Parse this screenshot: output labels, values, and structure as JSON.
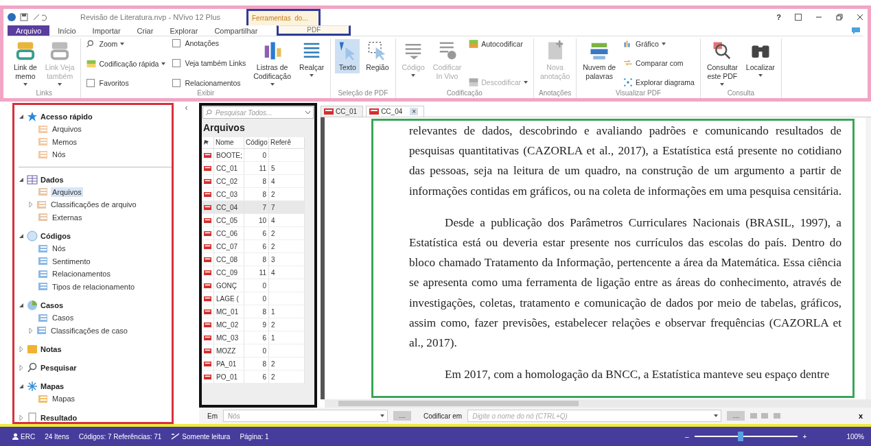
{
  "title_bar": {
    "title": "Revisão de Literatura.nvp - NVivo 12 Plus",
    "context_group": "Ferramentas  do...",
    "help": "?"
  },
  "ribbon_tabs": [
    {
      "label": "Arquivo",
      "selected": true
    },
    {
      "label": "Início",
      "selected": false
    },
    {
      "label": "Importar",
      "selected": false
    },
    {
      "label": "Criar",
      "selected": false
    },
    {
      "label": "Explorar",
      "selected": false
    },
    {
      "label": "Compartilhar",
      "selected": false
    }
  ],
  "context_tab": {
    "label": "PDF",
    "selected": false
  },
  "ribbon_groups": [
    {
      "label": "Links",
      "columns": [
        [
          {
            "kind": "large",
            "label": "Link de\nmemo",
            "dropdown": true,
            "disabled": false,
            "selected": false
          }
        ],
        [
          {
            "kind": "large",
            "label": "Link Veja\ntambém",
            "dropdown": true,
            "disabled": true,
            "selected": false
          }
        ]
      ]
    },
    {
      "label": "Exibir",
      "columns": [
        [
          {
            "kind": "small",
            "label": "Zoom",
            "dropdown": true,
            "disabled": false
          },
          {
            "kind": "small",
            "label": "Codificação rápida",
            "dropdown": true,
            "disabled": false
          },
          {
            "kind": "check",
            "label": "Favoritos",
            "checked": false
          }
        ],
        [
          {
            "kind": "check",
            "label": "Anotações",
            "checked": false
          },
          {
            "kind": "check",
            "label": "Veja também Links",
            "checked": false
          },
          {
            "kind": "check",
            "label": "Relacionamentos",
            "checked": false
          }
        ],
        [
          {
            "kind": "large",
            "label": "Listras de\nCodificação",
            "dropdown": true,
            "disabled": false,
            "selected": false
          }
        ],
        [
          {
            "kind": "large",
            "label": "Realçar",
            "dropdown": true,
            "disabled": false,
            "selected": false
          }
        ]
      ]
    },
    {
      "label": "Seleção de PDF",
      "columns": [
        [
          {
            "kind": "large",
            "label": "Texto",
            "dropdown": false,
            "disabled": false,
            "selected": true
          }
        ],
        [
          {
            "kind": "large",
            "label": "Região",
            "dropdown": false,
            "disabled": false,
            "selected": false
          }
        ]
      ]
    },
    {
      "label": "Codificação",
      "columns": [
        [
          {
            "kind": "large",
            "label": "Código",
            "dropdown": true,
            "disabled": true,
            "selected": false
          }
        ],
        [
          {
            "kind": "large",
            "label": "Codificar\nIn Vivo",
            "dropdown": false,
            "disabled": true,
            "selected": false
          }
        ],
        [
          {
            "kind": "small",
            "label": "Autocodificar",
            "dropdown": false,
            "disabled": false
          },
          {
            "kind": "small",
            "label": "Descodificar",
            "dropdown": true,
            "disabled": true
          }
        ]
      ]
    },
    {
      "label": "Anotações",
      "columns": [
        [
          {
            "kind": "large",
            "label": "Nova\nanotação",
            "dropdown": false,
            "disabled": true,
            "selected": false
          }
        ]
      ]
    },
    {
      "label": "Visualizar PDF",
      "columns": [
        [
          {
            "kind": "large",
            "label": "Nuvem de\npalavras",
            "dropdown": false,
            "disabled": false,
            "selected": false
          }
        ],
        [
          {
            "kind": "small",
            "label": "Gráfico",
            "dropdown": true,
            "disabled": false
          },
          {
            "kind": "small",
            "label": "Comparar com",
            "dropdown": false,
            "disabled": false
          },
          {
            "kind": "small",
            "label": "Explorar diagrama",
            "dropdown": false,
            "disabled": false
          }
        ]
      ]
    },
    {
      "label": "Consulta",
      "columns": [
        [
          {
            "kind": "large",
            "label": "Consultar\neste PDF",
            "dropdown": true,
            "disabled": false,
            "selected": false
          }
        ],
        [
          {
            "kind": "large",
            "label": "Localizar",
            "dropdown": true,
            "disabled": false,
            "selected": false
          }
        ]
      ]
    }
  ],
  "navigation": [
    {
      "label": "Acesso rápido",
      "expanded": true,
      "children": [
        {
          "label": "Arquivos",
          "selected": false
        },
        {
          "label": "Memos",
          "selected": false
        },
        {
          "label": "Nós",
          "selected": false
        }
      ]
    },
    {
      "label": "Dados",
      "expanded": true,
      "children": [
        {
          "label": "Arquivos",
          "selected": true
        },
        {
          "label": "Classificações de arquivo",
          "selected": false,
          "expanded": false
        },
        {
          "label": "Externas",
          "selected": false
        }
      ]
    },
    {
      "label": "Códigos",
      "expanded": true,
      "children": [
        {
          "label": "Nós",
          "selected": false
        },
        {
          "label": "Sentimento",
          "selected": false
        },
        {
          "label": "Relacionamentos",
          "selected": false
        },
        {
          "label": "Tipos de relacionamento",
          "selected": false
        }
      ]
    },
    {
      "label": "Casos",
      "expanded": true,
      "children": [
        {
          "label": "Casos",
          "selected": false
        },
        {
          "label": "Classificações de caso",
          "selected": false,
          "expanded": false
        }
      ]
    },
    {
      "label": "Notas",
      "expanded": false
    },
    {
      "label": "Pesquisar",
      "expanded": false
    },
    {
      "label": "Mapas",
      "expanded": true,
      "children": [
        {
          "label": "Mapas",
          "selected": false
        }
      ]
    },
    {
      "label": "Resultado",
      "expanded": false
    }
  ],
  "collapse": "‹",
  "file_list": {
    "search": {
      "placeholder": "Pesquisar Todos..."
    },
    "title": "Arquivos",
    "columns": [
      "Nome",
      "Código",
      "Referê"
    ],
    "rows": [
      {
        "name": "BOOTE;",
        "code": "0",
        "ref": "",
        "selected": false
      },
      {
        "name": "CC_01",
        "code": "11",
        "ref": "5",
        "selected": false
      },
      {
        "name": "CC_02",
        "code": "8",
        "ref": "4",
        "selected": false
      },
      {
        "name": "CC_03",
        "code": "8",
        "ref": "2",
        "selected": false
      },
      {
        "name": "CC_04",
        "code": "7",
        "ref": "7",
        "selected": true
      },
      {
        "name": "CC_05",
        "code": "10",
        "ref": "4",
        "selected": false
      },
      {
        "name": "CC_06",
        "code": "6",
        "ref": "2",
        "selected": false
      },
      {
        "name": "CC_07",
        "code": "6",
        "ref": "2",
        "selected": false
      },
      {
        "name": "CC_08",
        "code": "8",
        "ref": "3",
        "selected": false
      },
      {
        "name": "CC_09",
        "code": "11",
        "ref": "4",
        "selected": false
      },
      {
        "name": "GONÇ",
        "code": "0",
        "ref": "",
        "selected": false
      },
      {
        "name": "LAGE (",
        "code": "0",
        "ref": "",
        "selected": false
      },
      {
        "name": "MC_01",
        "code": "8",
        "ref": "1",
        "selected": false
      },
      {
        "name": "MC_02",
        "code": "9",
        "ref": "2",
        "selected": false
      },
      {
        "name": "MC_03",
        "code": "6",
        "ref": "1",
        "selected": false
      },
      {
        "name": "MOZZ",
        "code": "0",
        "ref": "",
        "selected": false
      },
      {
        "name": "PA_01",
        "code": "8",
        "ref": "2",
        "selected": false
      },
      {
        "name": "PO_01",
        "code": "6",
        "ref": "2",
        "selected": false
      }
    ]
  },
  "document": {
    "tabs": [
      {
        "label": "CC_01",
        "selected": false
      },
      {
        "label": "CC_04",
        "selected": true,
        "close": "×"
      }
    ],
    "paragraphs": [
      {
        "indent": false,
        "text": "relevantes de dados, descobrindo e avaliando padrões e comunicando resultados de pesquisas quantitativas (CAZORLA et al., 2017), a Estatística está presente no cotidiano das pessoas, seja na leitura de um quadro, na construção de um argumento a partir de informações contidas em gráficos, ou na coleta de informações em uma pesquisa censitária."
      },
      {
        "indent": true,
        "text": "Desde a publicação dos Parâmetros Curriculares Nacionais (BRASIL, 1997), a Estatística está ou deveria estar presente nos currículos das escolas do país. Dentro do bloco chamado Tratamento da Informação, pertencente a área da Matemática. Essa ciência se apresenta como uma ferramenta de ligação entre as áreas do conhecimento, através de investigações, coletas, tratamento e comunicação de dados por meio de tabelas, gráficos, assim como, fazer previsões, estabelecer relações e observar frequências (CAZORLA et al., 2017)."
      },
      {
        "indent": true,
        "text": "Em 2017, com a homologação da BNCC, a Estatística manteve seu espaço dentre"
      }
    ]
  },
  "coding_bar": {
    "in_label": "Em",
    "in_value": "Nós",
    "browse_buttons": [
      "....",
      "...."
    ],
    "code_label": "Codificar em",
    "placeholder": "Digite o nome do nó (CTRL+Q)",
    "close": "x"
  },
  "status_bar": {
    "user": "ERC",
    "items": "24 Itens",
    "counts": "Códigos: 7 Referências: 71",
    "mode": "Somente leitura",
    "page": "Página: 1",
    "zoom": {
      "minus": "–",
      "plus": "+",
      "level": 0.45,
      "reading": "100%"
    }
  }
}
